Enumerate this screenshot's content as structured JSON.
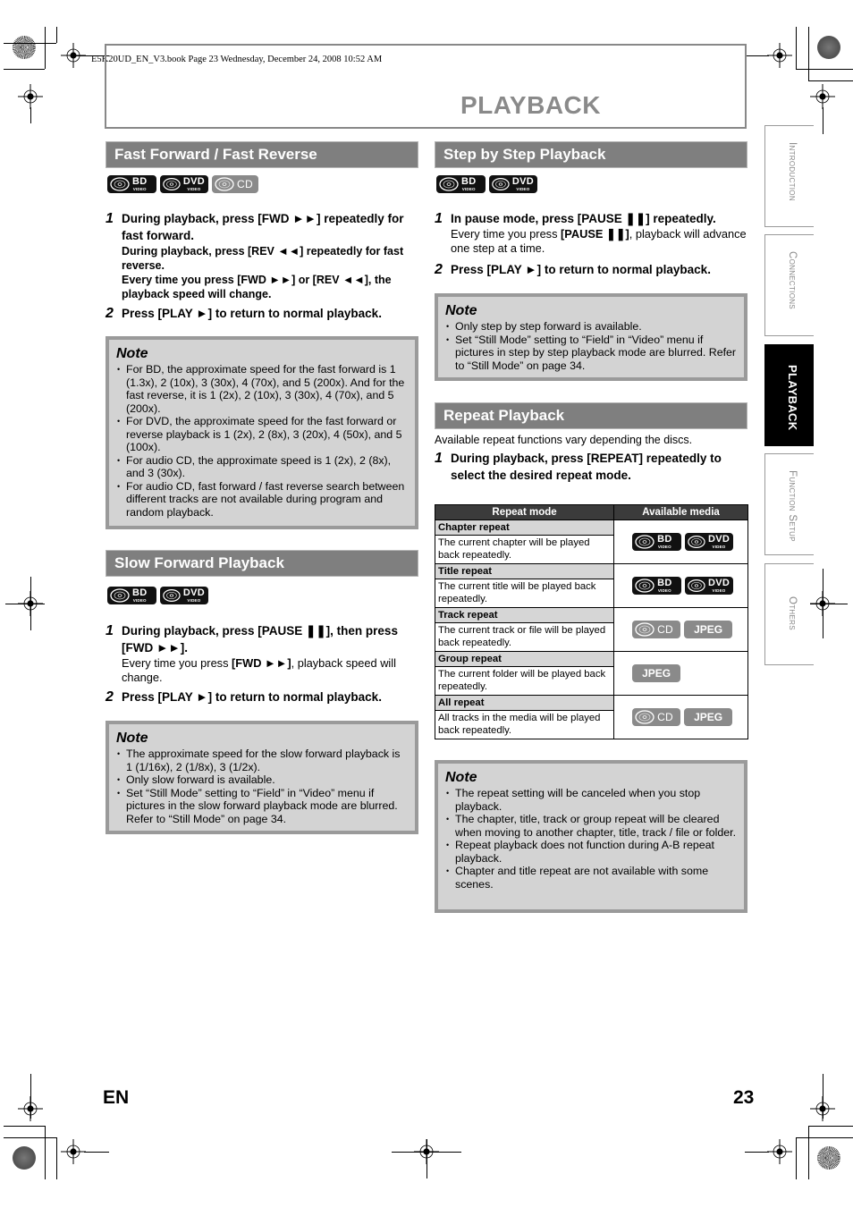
{
  "header": {
    "file_info": "E5K20UD_EN_V3.book  Page 23  Wednesday, December 24, 2008  10:52 AM",
    "page_title": "PLAYBACK"
  },
  "side_tabs": [
    {
      "label": "Introduction",
      "active": false
    },
    {
      "label": "Connections",
      "active": false
    },
    {
      "label": "Playback",
      "active": true
    },
    {
      "label": "Function Setup",
      "active": false
    },
    {
      "label": "Others",
      "active": false
    }
  ],
  "media_labels": {
    "bd": "BD",
    "dvd": "DVD",
    "video": "VIDEO",
    "cd": "CD",
    "jpeg": "JPEG"
  },
  "fast_forward": {
    "heading": "Fast Forward / Fast Reverse",
    "media": [
      "BD VIDEO",
      "DVD VIDEO",
      "CD"
    ],
    "steps": [
      {
        "num": "1",
        "text": "During playback, press [FWD ►►] repeatedly for fast forward.",
        "sub": [
          "During playback, press [REV ◄◄] repeatedly for fast reverse.",
          "Every time you press [FWD ►►] or [REV ◄◄], the playback speed will change."
        ]
      },
      {
        "num": "2",
        "text": "Press [PLAY ►] to return to normal playback."
      }
    ],
    "note": {
      "title": "Note",
      "items": [
        "For BD, the approximate speed for the fast forward is 1 (1.3x), 2 (10x), 3 (30x), 4 (70x), and 5 (200x). And for the fast reverse, it is 1 (2x), 2 (10x), 3 (30x), 4 (70x), and 5 (200x).",
        "For DVD, the approximate speed for the fast forward or reverse playback is 1 (2x), 2 (8x), 3 (20x), 4 (50x), and 5 (100x).",
        "For audio CD, the approximate speed is 1 (2x), 2 (8x), and 3 (30x).",
        "For audio CD, fast forward / fast reverse search between different tracks are not available during program and random playback."
      ]
    }
  },
  "slow_forward": {
    "heading": "Slow Forward Playback",
    "media": [
      "BD VIDEO",
      "DVD VIDEO"
    ],
    "steps": [
      {
        "num": "1",
        "text": "During playback, press [PAUSE ❚❚], then press [FWD ►►].",
        "sub_prefix": "Every time you press ",
        "sub_bold": "[FWD ►►]",
        "sub_suffix": ", playback speed will change."
      },
      {
        "num": "2",
        "text": "Press [PLAY ►] to return to normal playback."
      }
    ],
    "note": {
      "title": "Note",
      "items": [
        "The approximate speed for the slow forward playback is 1 (1/16x), 2 (1/8x), 3 (1/2x).",
        "Only slow forward is available.",
        "Set “Still Mode” setting to “Field” in “Video” menu if pictures in the slow forward playback mode are blurred. Refer to “Still Mode” on page 34."
      ]
    }
  },
  "step_by_step": {
    "heading": "Step by Step Playback",
    "media": [
      "BD VIDEO",
      "DVD VIDEO"
    ],
    "steps": [
      {
        "num": "1",
        "text": "In pause mode, press [PAUSE ❚❚] repeatedly.",
        "sub_prefix": "Every time you press ",
        "sub_bold": "[PAUSE ❚❚]",
        "sub_suffix": ", playback will advance one step at a time."
      },
      {
        "num": "2",
        "text": "Press [PLAY ►] to return to normal playback."
      }
    ],
    "note": {
      "title": "Note",
      "items": [
        "Only step by step forward is available.",
        "Set “Still Mode” setting to “Field” in “Video” menu if pictures in step by step playback mode are blurred. Refer to “Still Mode” on page 34."
      ]
    }
  },
  "repeat": {
    "heading": "Repeat Playback",
    "intro": "Available repeat functions vary depending the discs.",
    "steps": [
      {
        "num": "1",
        "text": "During playback, press [REPEAT] repeatedly to select the desired repeat mode."
      }
    ],
    "table": {
      "headers": [
        "Repeat mode",
        "Available media"
      ],
      "rows": [
        {
          "mode": "Chapter repeat",
          "desc": "The current chapter will be played back repeatedly.",
          "media": [
            "BD VIDEO",
            "DVD VIDEO"
          ]
        },
        {
          "mode": "Title repeat",
          "desc": "The current title will be played back repeatedly.",
          "media": [
            "BD VIDEO",
            "DVD VIDEO"
          ]
        },
        {
          "mode": "Track repeat",
          "desc": "The current track or file will be played back repeatedly.",
          "media": [
            "CD",
            "JPEG"
          ]
        },
        {
          "mode": "Group repeat",
          "desc": "The current folder will be played back repeatedly.",
          "media": [
            "JPEG"
          ]
        },
        {
          "mode": "All repeat",
          "desc": "All tracks in the media will be played back repeatedly.",
          "media": [
            "CD",
            "JPEG"
          ]
        }
      ]
    },
    "note": {
      "title": "Note",
      "items": [
        "The repeat setting will be canceled when you stop playback.",
        "The chapter, title, track or group repeat will be cleared when moving to another chapter, title, track / file or folder.",
        "Repeat playback does not function during A-B repeat playback.",
        "Chapter and title repeat are not available with some scenes."
      ]
    }
  },
  "footer": {
    "language": "EN",
    "page_number": "23"
  }
}
